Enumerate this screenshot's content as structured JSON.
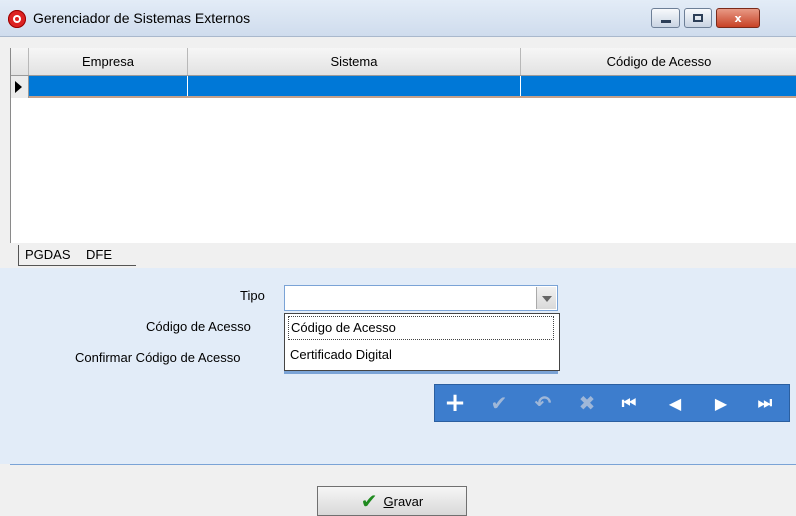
{
  "window": {
    "title": "Gerenciador de Sistemas Externos",
    "close_glyph": "x"
  },
  "grid": {
    "columns": [
      "Empresa",
      "Sistema",
      "Código de Acesso"
    ],
    "rows": [
      [
        "",
        "",
        ""
      ]
    ],
    "selected_row_color": "#0078d7"
  },
  "tabs": [
    {
      "label": "PGDAS"
    },
    {
      "label": "DFE"
    }
  ],
  "form": {
    "tipo_label": "Tipo",
    "tipo_value": "",
    "codigo_label": "Código de Acesso",
    "confirmar_label": "Confirmar Código de Acesso",
    "dropdown_options": [
      "Código de Acesso",
      "Certificado Digital"
    ]
  },
  "navigator": {
    "buttons": [
      {
        "name": "add-icon",
        "glyph": "+"
      },
      {
        "name": "confirm-icon",
        "glyph": "✔"
      },
      {
        "name": "undo-icon",
        "glyph": "↶"
      },
      {
        "name": "delete-icon",
        "glyph": "✖"
      },
      {
        "name": "first-icon",
        "glyph": "⏮"
      },
      {
        "name": "prior-icon",
        "glyph": "◀"
      },
      {
        "name": "next-icon",
        "glyph": "▶"
      },
      {
        "name": "last-icon",
        "glyph": "⏭"
      }
    ],
    "bar_color": "#3d7dcd"
  },
  "footer": {
    "gravar_first": "G",
    "gravar_rest": "ravar",
    "gravar_icon": "✔"
  }
}
